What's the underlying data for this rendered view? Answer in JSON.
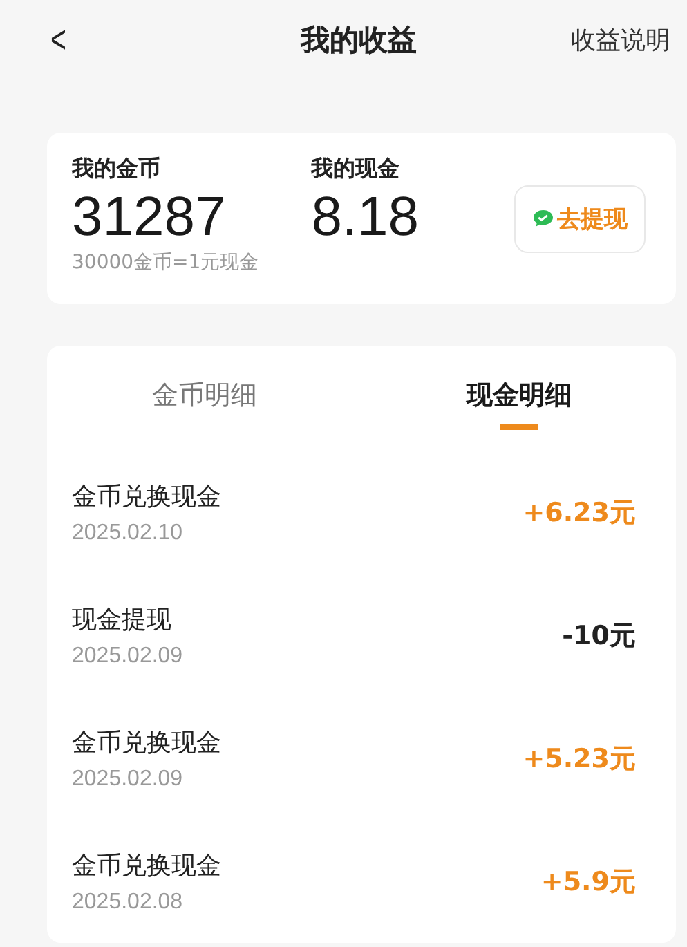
{
  "nav": {
    "back": "<",
    "title": "我的收益",
    "action": "收益说明"
  },
  "balance": {
    "coins_label": "我的金币",
    "coins": "31287",
    "rate": "30000金币=1元现金",
    "cash_label": "我的现金",
    "cash": "8.18",
    "withdraw_button": "去提现"
  },
  "tabs": [
    {
      "label": "金币明细",
      "selected": false
    },
    {
      "label": "现金明细",
      "selected": true
    }
  ],
  "records": [
    {
      "title": "金币兑换现金",
      "date": "2025.02.10",
      "amount": "+6.23元",
      "kind": "income"
    },
    {
      "title": "现金提现",
      "date": "2025.02.09",
      "amount": "-10元",
      "kind": "expense"
    },
    {
      "title": "金币兑换现金",
      "date": "2025.02.09",
      "amount": "+5.23元",
      "kind": "income"
    },
    {
      "title": "金币兑换现金",
      "date": "2025.02.08",
      "amount": "+5.9元",
      "kind": "income"
    }
  ]
}
